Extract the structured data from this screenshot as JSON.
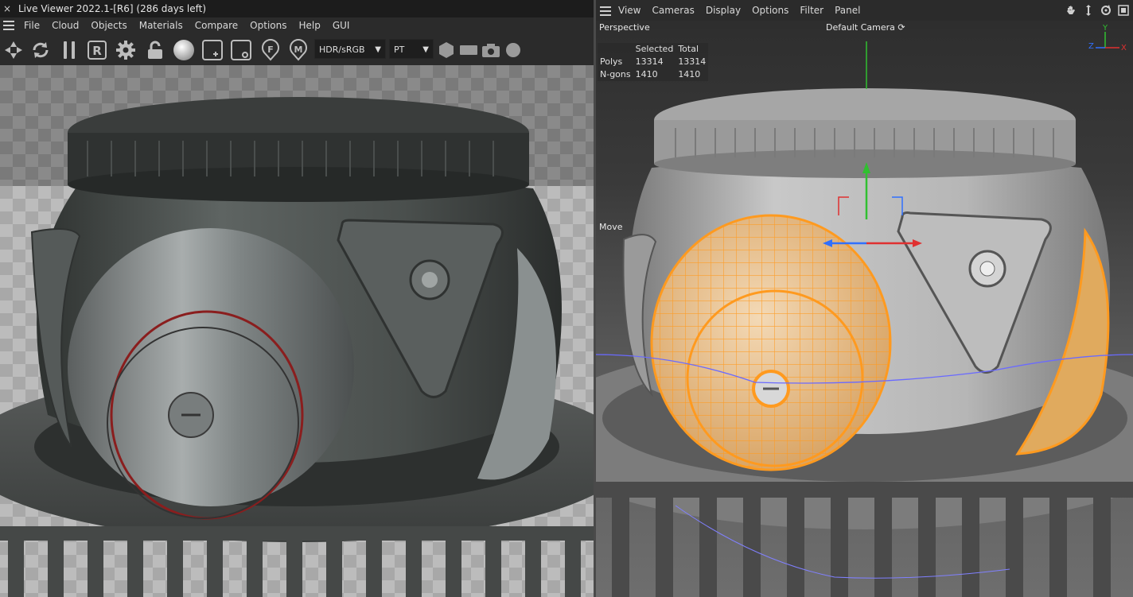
{
  "live_viewer": {
    "close_glyph": "×",
    "title": "Live Viewer 2022.1-[R6] (286 days left)",
    "menu": [
      "File",
      "Cloud",
      "Objects",
      "Materials",
      "Compare",
      "Options",
      "Help",
      "GUI"
    ],
    "toolbar": {
      "icons": [
        "aperture-icon",
        "refresh-icon",
        "pause-icon",
        "region-render-icon",
        "settings-gear-icon",
        "lock-icon",
        "sphere-material-icon",
        "add-icon",
        "remove-icon",
        "focus-pick-icon",
        "material-pick-icon"
      ],
      "region_letter": "R",
      "focus_letter": "F",
      "material_letter": "M",
      "color_space": "HDR/sRGB",
      "kernel": "PT",
      "trailing_icons": [
        "hexagon-icon",
        "rectangle-icon",
        "camera-icon",
        "circle-icon"
      ]
    }
  },
  "viewport": {
    "menu": [
      "View",
      "Cameras",
      "Display",
      "Options",
      "Filter",
      "Panel"
    ],
    "nav_icons": [
      "pan-hand-icon",
      "move-arrows-icon",
      "rotate-icon",
      "maximize-icon"
    ],
    "projection": "Perspective",
    "camera": "Default Camera",
    "camera_glyph": "⟳",
    "tool_label": "Move",
    "stats": {
      "header": [
        "",
        "Selected",
        "Total"
      ],
      "rows": [
        {
          "label": "Polys",
          "selected": "13314",
          "total": "13314"
        },
        {
          "label": "N-gons",
          "selected": "1410",
          "total": "1410"
        }
      ]
    },
    "axis_labels": {
      "y": "Y",
      "z": "Z",
      "x": "X"
    },
    "colors": {
      "selection": "#ff9a1f",
      "axis_x": "#e03030",
      "axis_y": "#30c030",
      "axis_z": "#3070ff"
    }
  }
}
